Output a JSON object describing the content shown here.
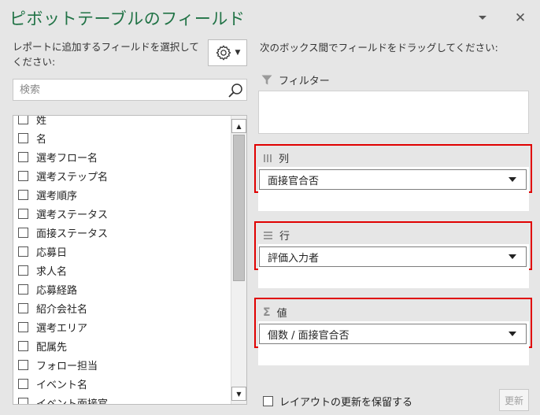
{
  "panel": {
    "title": "ピボットテーブルのフィールド",
    "close_glyph": "✕"
  },
  "left": {
    "instruction": "レポートに追加するフィールドを選択してください:",
    "search_placeholder": "検索",
    "fields": [
      {
        "label": "姓",
        "checked": false
      },
      {
        "label": "名",
        "checked": false
      },
      {
        "label": "選考フロー名",
        "checked": false
      },
      {
        "label": "選考ステップ名",
        "checked": false
      },
      {
        "label": "選考順序",
        "checked": false
      },
      {
        "label": "選考ステータス",
        "checked": false
      },
      {
        "label": "面接ステータス",
        "checked": false
      },
      {
        "label": "応募日",
        "checked": false
      },
      {
        "label": "求人名",
        "checked": false
      },
      {
        "label": "応募経路",
        "checked": false
      },
      {
        "label": "紹介会社名",
        "checked": false
      },
      {
        "label": "選考エリア",
        "checked": false
      },
      {
        "label": "配属先",
        "checked": false
      },
      {
        "label": "フォロー担当",
        "checked": false
      },
      {
        "label": "イベント名",
        "checked": false
      },
      {
        "label": "イベント面接官",
        "checked": false
      }
    ]
  },
  "right": {
    "instruction": "次のボックス間でフィールドをドラッグしてください:",
    "filters": {
      "label": "フィルター"
    },
    "columns": {
      "label": "列",
      "field": "面接官合否"
    },
    "rows": {
      "label": "行",
      "field": "評価入力者"
    },
    "values": {
      "label": "値",
      "field": "個数 / 面接官合否"
    }
  },
  "footer": {
    "defer_label": "レイアウトの更新を保留する",
    "defer_checked": false,
    "update_label": "更新",
    "update_enabled": false
  },
  "colors": {
    "title_green": "#217346",
    "highlight_red": "#e00000",
    "panel_bg": "#e6e6e6"
  }
}
